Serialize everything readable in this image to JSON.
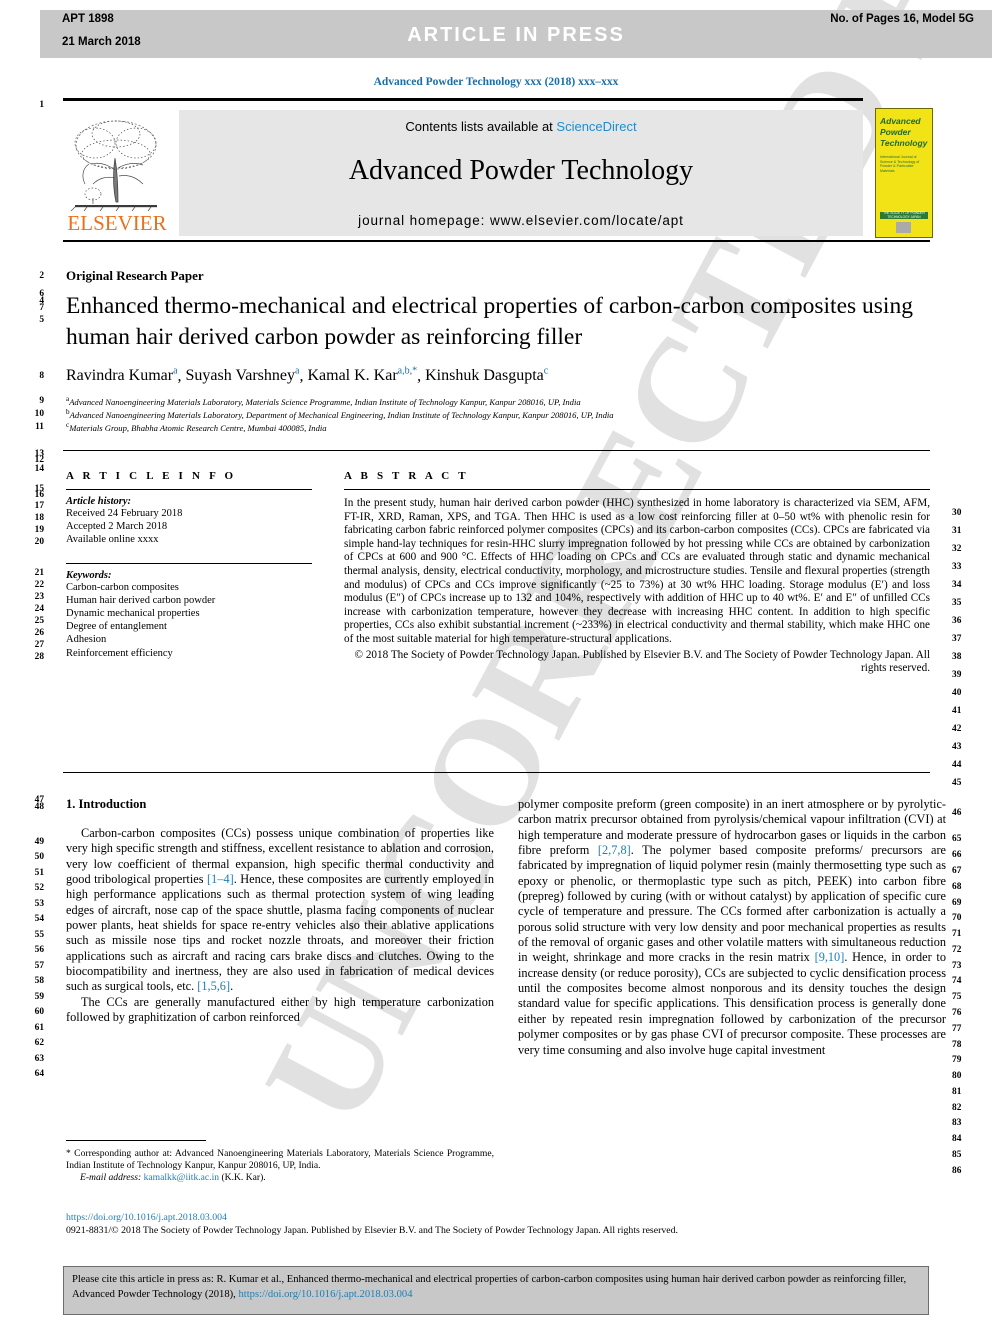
{
  "header": {
    "article_id": "APT 1898",
    "date": "21 March 2018",
    "status": "ARTICLE  IN  PRESS",
    "pages_model": "No. of Pages 16, Model 5G"
  },
  "running_head": "Advanced Powder Technology xxx (2018) xxx–xxx",
  "masthead": {
    "contents_prefix": "Contents lists available at ",
    "sciencedirect": "ScienceDirect",
    "journal_title": "Advanced Powder Technology",
    "homepage": "journal homepage: www.elsevier.com/locate/apt",
    "publisher": "ELSEVIER",
    "cover": {
      "line1": "Advanced",
      "line2": "Powder",
      "line3": "Technology",
      "subtitle": "International Journal of Science & Technology of Powder & Particulate Materials",
      "band": "THE SOCIETY OF POWDER TECHNOLOGY JAPAN"
    }
  },
  "article_type": "Original Research Paper",
  "title": "Enhanced thermo-mechanical and electrical properties of carbon-carbon composites using human hair derived carbon powder as reinforcing filler",
  "authors": [
    {
      "name": "Ravindra Kumar",
      "sup": "a"
    },
    {
      "name": "Suyash Varshney",
      "sup": "a"
    },
    {
      "name": "Kamal K. Kar",
      "sup": "a,b,*"
    },
    {
      "name": "Kinshuk Dasgupta",
      "sup": "c"
    }
  ],
  "affiliations": [
    {
      "sup": "a",
      "text": "Advanced Nanoengineering Materials Laboratory, Materials Science Programme, Indian Institute of Technology Kanpur, Kanpur 208016, UP, India"
    },
    {
      "sup": "b",
      "text": "Advanced Nanoengineering Materials Laboratory, Department of Mechanical Engineering, Indian Institute of Technology Kanpur, Kanpur 208016, UP, India"
    },
    {
      "sup": "c",
      "text": "Materials Group, Bhabha Atomic Research Centre, Mumbai 400085, India"
    }
  ],
  "article_info": {
    "heading": "A R T I C L E   I N F O",
    "history_label": "Article history:",
    "history": [
      "Received 24 February 2018",
      "Accepted 2 March 2018",
      "Available online xxxx"
    ],
    "keywords_label": "Keywords:",
    "keywords": [
      "Carbon-carbon composites",
      "Human hair derived carbon powder",
      "Dynamic mechanical properties",
      "Degree of entanglement",
      "Adhesion",
      "Reinforcement efficiency"
    ]
  },
  "abstract": {
    "heading": "A B S T R A C T",
    "body": "In the present study, human hair derived carbon powder (HHC) synthesized in home laboratory is characterized via SEM, AFM, FT-IR, XRD, Raman, XPS, and TGA. Then HHC is used as a low cost reinforcing filler at 0–50 wt% with phenolic resin for fabricating carbon fabric reinforced polymer composites (CPCs) and its carbon-carbon composites (CCs). CPCs are fabricated via simple hand-lay techniques for resin-HHC slurry impregnation followed by hot pressing while CCs are obtained by carbonization of CPCs at 600 and 900 °C. Effects of HHC loading on CPCs and CCs are evaluated through static and dynamic mechanical thermal analysis, density, electrical conductivity, morphology, and microstructure studies. Tensile and flexural properties (strength and modulus) of CPCs and CCs improve significantly (~25 to 73%) at 30 wt% HHC loading. Storage modulus (E′) and loss modulus (E″) of CPCs increase up to 132 and 104%, respectively with addition of HHC up to 40 wt%. E′ and E″ of unfilled CCs increase with carbonization temperature, however they decrease with increasing HHC content. In addition to high specific properties, CCs also exhibit substantial increment (~233%) in electrical conductivity and thermal stability, which make HHC one of the most suitable material for high temperature-structural applications.",
    "copyright": "© 2018 The Society of Powder Technology Japan. Published by Elsevier B.V. and The Society of Powder Technology Japan. All rights reserved."
  },
  "section": {
    "heading": "1. Introduction",
    "left_paragraphs": [
      "Carbon-carbon composites (CCs) possess unique combination of properties like very high specific strength and stiffness, excellent resistance to ablation and corrosion, very low coefficient of thermal expansion, high specific thermal conductivity and good tribological properties [1–4]. Hence, these composites are currently employed in high performance applications such as thermal protection system of wing leading edges of aircraft, nose cap of the space shuttle, plasma facing components of nuclear power plants, heat shields for space re-entry vehicles also their ablative applications such as missile nose tips and rocket nozzle throats, and moreover their friction applications such as aircraft and racing cars brake discs and clutches. Owing to the biocompatibility and inertness, they are also used in fabrication of medical devices such as surgical tools, etc. [1,5,6].",
      "The CCs are generally manufactured either by high temperature carbonization followed by graphitization of carbon reinforced"
    ],
    "right_paragraphs": [
      "polymer composite preform (green composite) in an inert atmosphere or by pyrolytic-carbon matrix precursor obtained from pyrolysis/chemical vapour infiltration (CVI) at high temperature and moderate pressure of hydrocarbon gases or liquids in the carbon fibre preform [2,7,8]. The polymer based composite preforms/ precursors are fabricated by impregnation of liquid polymer resin (mainly thermosetting type such as epoxy or phenolic, or thermoplastic type such as pitch, PEEK) into carbon fibre (prepreg) followed by curing (with or without catalyst) by application of specific cure cycle of temperature and pressure. The CCs formed after carbonization is actually a porous solid structure with very low density and poor mechanical properties as results of the removal of organic gases and other volatile matters with simultaneous reduction in weight, shrinkage and more cracks in the resin matrix [9,10]. Hence, in order to increase density (or reduce porosity), CCs are subjected to cyclic densification process until the composites become almost nonporous and its density touches the design standard value for specific applications. This densification process is generally done either by repeated resin impregnation followed by carbonization of the precursor polymer composites or by gas phase CVI of precursor composite. These processes are very time consuming and also involve huge capital investment"
    ]
  },
  "footnote": {
    "corresponding": "* Corresponding author at: Advanced Nanoengineering Materials Laboratory, Materials Science Programme, Indian Institute of Technology Kanpur, Kanpur 208016, UP, India.",
    "email_label": "E-mail address:",
    "email": "kamalkk@iitk.ac.in",
    "email_suffix": "(K.K. Kar).",
    "doi": "https://doi.org/10.1016/j.apt.2018.03.004",
    "issn": "0921-8831/© 2018 The Society of Powder Technology Japan. Published by Elsevier B.V. and The Society of Powder Technology Japan. All rights reserved."
  },
  "cite_box": {
    "text_before": "Please cite this article in press as: R. Kumar et al., Enhanced thermo-mechanical and electrical properties of carbon-carbon composites using human hair derived carbon powder as reinforcing filler, Advanced Powder Technology (2018), ",
    "link": "https://doi.org/10.1016/j.apt.2018.03.004"
  },
  "watermark": "UNCORRECTED PROOF",
  "line_numbers": {
    "left": [
      "1",
      "2",
      "6",
      "4",
      "7",
      "5",
      "8",
      "9",
      "10",
      "11",
      "13",
      "12",
      "14",
      "15",
      "16",
      "17",
      "18",
      "19",
      "20",
      "21",
      "22",
      "23",
      "24",
      "25",
      "26",
      "27",
      "28",
      "47",
      "48",
      "49",
      "50",
      "51",
      "52",
      "53",
      "54",
      "55",
      "56",
      "57",
      "58",
      "59",
      "60",
      "61",
      "62",
      "63",
      "64"
    ],
    "right": [
      "30",
      "31",
      "32",
      "33",
      "34",
      "35",
      "36",
      "37",
      "38",
      "39",
      "40",
      "41",
      "42",
      "43",
      "44",
      "45",
      "46",
      "65",
      "66",
      "67",
      "68",
      "69",
      "70",
      "71",
      "72",
      "73",
      "74",
      "75",
      "76",
      "77",
      "78",
      "79",
      "80",
      "81",
      "82",
      "83",
      "84",
      "85",
      "86"
    ]
  },
  "colors": {
    "link": "#1a7fb8",
    "elsevier_orange": "#e8721c",
    "cover_yellow": "#f2e316",
    "header_grey": "#c8c8c8"
  }
}
